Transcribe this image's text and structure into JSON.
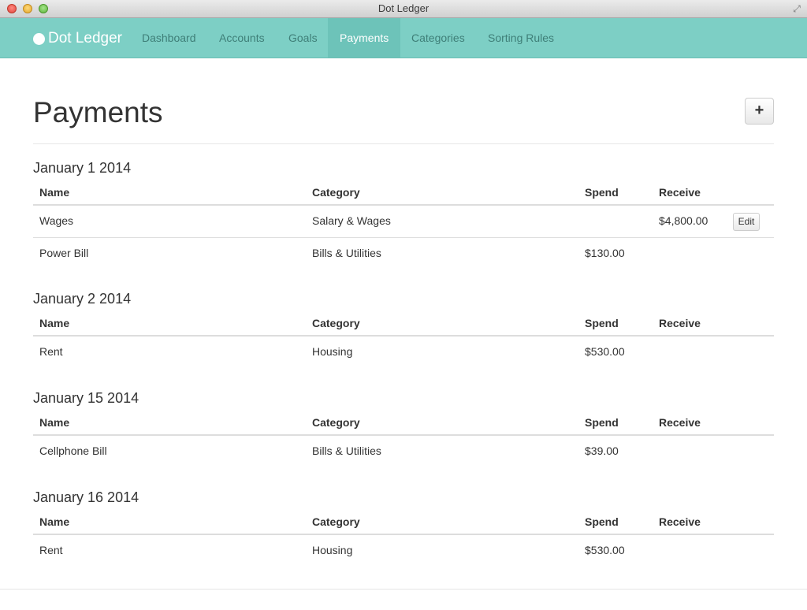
{
  "window": {
    "title": "Dot Ledger"
  },
  "navbar": {
    "brand": "Dot Ledger",
    "items": [
      {
        "label": "Dashboard"
      },
      {
        "label": "Accounts"
      },
      {
        "label": "Goals"
      },
      {
        "label": "Payments",
        "active": true
      },
      {
        "label": "Categories"
      },
      {
        "label": "Sorting Rules"
      }
    ]
  },
  "page": {
    "title": "Payments",
    "add_button": "+"
  },
  "table_headers": {
    "name": "Name",
    "category": "Category",
    "spend": "Spend",
    "receive": "Receive"
  },
  "groups": [
    {
      "date": "January 1 2014",
      "rows": [
        {
          "name": "Wages",
          "category": "Salary & Wages",
          "spend": "",
          "receive": "$4,800.00",
          "edit": "Edit"
        },
        {
          "name": "Power Bill",
          "category": "Bills & Utilities",
          "spend": "$130.00",
          "receive": ""
        }
      ]
    },
    {
      "date": "January 2 2014",
      "rows": [
        {
          "name": "Rent",
          "category": "Housing",
          "spend": "$530.00",
          "receive": ""
        }
      ]
    },
    {
      "date": "January 15 2014",
      "rows": [
        {
          "name": "Cellphone Bill",
          "category": "Bills & Utilities",
          "spend": "$39.00",
          "receive": ""
        }
      ]
    },
    {
      "date": "January 16 2014",
      "rows": [
        {
          "name": "Rent",
          "category": "Housing",
          "spend": "$530.00",
          "receive": ""
        }
      ]
    }
  ],
  "colors": {
    "navbar": "#7dcfc5",
    "nav_active": "#6dc3b9",
    "nav_text": "#3f7f78"
  }
}
